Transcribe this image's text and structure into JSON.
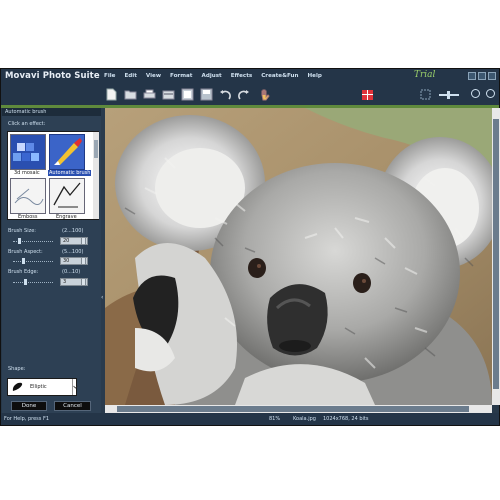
{
  "app_title": "Movavi Photo Suite",
  "trial_label": "Trial",
  "menu": [
    "File",
    "Edit",
    "View",
    "Format",
    "Adjust",
    "Effects",
    "Create&Fun",
    "Help"
  ],
  "toolbar_icons": [
    "new-doc-icon",
    "open-folder-icon",
    "print-icon",
    "scan-icon",
    "filmstrip-icon",
    "save-icon",
    "undo-icon",
    "redo-icon",
    "hand-icon",
    "gift-icon"
  ],
  "panel": {
    "header": "Automatic brush",
    "click_label": "Click an effect:",
    "effects": [
      {
        "label": "3d mosaic"
      },
      {
        "label": "Automatic brush"
      },
      {
        "label": "Emboss"
      },
      {
        "label": "Engrave"
      }
    ],
    "brush_size": {
      "label": "Brush Size:",
      "range": "(2...100)",
      "value": "20"
    },
    "brush_aspect": {
      "label": "Brush Aspect:",
      "range": "(5...100)",
      "value": "30"
    },
    "brush_edge": {
      "label": "Brush Edge:",
      "range": "(0...10)",
      "value": "3"
    },
    "shape_label": "Shape:",
    "shape_value": "Elliptic",
    "done_label": "Done",
    "cancel_label": "Cancel"
  },
  "status": {
    "help": "For Help, press F1",
    "zoom": "81%",
    "file": "Koala.jpg",
    "info": "1024x768, 24 bits"
  },
  "colors": {
    "accent_green": "#5f8a3c",
    "window_bg": "#28394a"
  }
}
